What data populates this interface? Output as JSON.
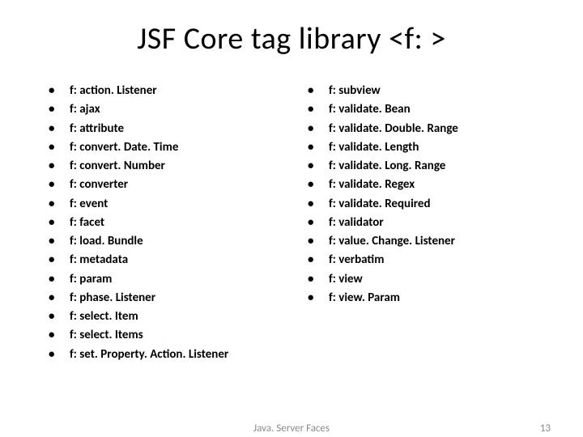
{
  "title": "JSF Core tag library <f: >",
  "left_items": [
    "f: action. Listener",
    "f: ajax",
    "f: attribute",
    "f: convert. Date. Time",
    "f: convert. Number",
    "f: converter",
    "f: event",
    "f: facet",
    "f: load. Bundle",
    "f: metadata",
    "f: param",
    "f: phase. Listener",
    "f: select. Item",
    "f: select. Items",
    "f: set. Property. Action. Listener"
  ],
  "right_items": [
    "f: subview",
    "f: validate. Bean",
    "f: validate. Double. Range",
    "f: validate. Length",
    "f: validate. Long. Range",
    "f: validate. Regex",
    "f: validate. Required",
    "f: validator",
    "f: value. Change. Listener",
    "f: verbatim",
    "f: view",
    "f: view. Param"
  ],
  "footer_center": "Java. Server Faces",
  "footer_right": "13"
}
